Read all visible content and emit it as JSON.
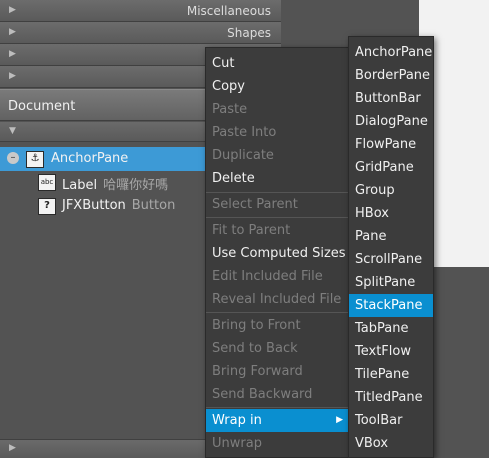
{
  "library": {
    "sections": [
      {
        "label": "Miscellaneous"
      },
      {
        "label": "Shapes"
      },
      {
        "label": ""
      },
      {
        "label": ""
      }
    ]
  },
  "document": {
    "title": "Document",
    "tree": [
      {
        "name": "AnchorPane",
        "sub": "",
        "icon": "anchor-icon"
      },
      {
        "name": "Label",
        "sub": "哈囉你好嗎",
        "icon": "label-icon"
      },
      {
        "name": "JFXButton",
        "sub": "Button",
        "icon": "unknown-component-icon"
      }
    ]
  },
  "context_menu": {
    "items": [
      {
        "label": "Cut",
        "enabled": true
      },
      {
        "label": "Copy",
        "enabled": true
      },
      {
        "label": "Paste",
        "enabled": false
      },
      {
        "label": "Paste Into",
        "enabled": false
      },
      {
        "label": "Duplicate",
        "enabled": false
      },
      {
        "label": "Delete",
        "enabled": true
      },
      {
        "label": "Select Parent",
        "enabled": false
      },
      {
        "label": "Fit to Parent",
        "enabled": false
      },
      {
        "label": "Use Computed Sizes",
        "enabled": true
      },
      {
        "label": "Edit Included File",
        "enabled": false
      },
      {
        "label": "Reveal Included File",
        "enabled": false
      },
      {
        "label": "Bring to Front",
        "enabled": false
      },
      {
        "label": "Send to Back",
        "enabled": false
      },
      {
        "label": "Bring Forward",
        "enabled": false
      },
      {
        "label": "Send Backward",
        "enabled": false
      },
      {
        "label": "Wrap in",
        "enabled": true,
        "highlighted": true,
        "submenu": true
      },
      {
        "label": "Unwrap",
        "enabled": false
      }
    ]
  },
  "wrap_submenu": {
    "items": [
      "AnchorPane",
      "BorderPane",
      "ButtonBar",
      "DialogPane",
      "FlowPane",
      "GridPane",
      "Group",
      "HBox",
      "Pane",
      "ScrollPane",
      "SplitPane",
      "StackPane",
      "TabPane",
      "TextFlow",
      "TilePane",
      "TitledPane",
      "ToolBar",
      "VBox"
    ],
    "highlighted": "StackPane"
  },
  "colors": {
    "selection": "#3d9ad6",
    "menu_highlight": "#0a8fd0",
    "menu_bg": "#3c3c3c",
    "panel_bg": "#535353"
  }
}
